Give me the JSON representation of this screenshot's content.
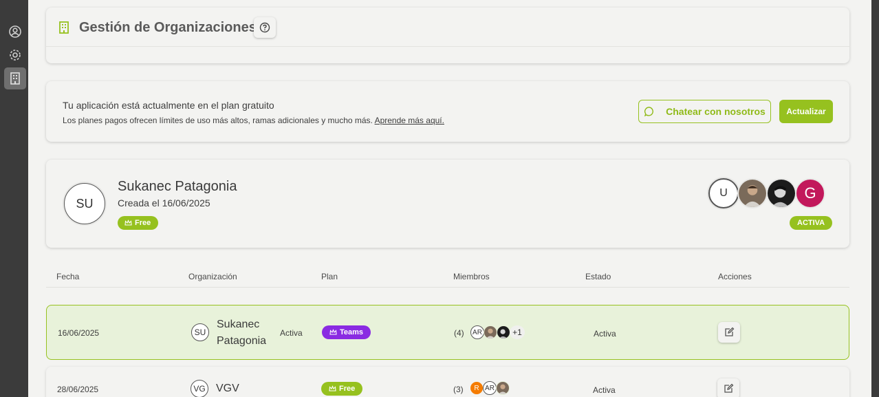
{
  "header": {
    "title": "Gestión de Organizaciones"
  },
  "plan_banner": {
    "line1": "Tu aplicación está actualmente en el plan gratuito",
    "line2": "Los planes pagos ofrecen límites de uso más altos, ramas adicionales y mucho más.",
    "learn_more": "Aprende más aquí.",
    "chat_label": "Chatear con nosotros",
    "upgrade_label": "Actualizar"
  },
  "org": {
    "initials": "SU",
    "name": "Sukanec Patagonia",
    "created": "Creada el 16/06/2025",
    "plan": "Free",
    "status": "ACTIVA",
    "members": [
      {
        "type": "initial",
        "label": "U"
      },
      {
        "type": "photo",
        "icon": "person-photo-1"
      },
      {
        "type": "photo",
        "icon": "person-photo-2"
      },
      {
        "type": "initial",
        "label": "G",
        "color": "#c2185b"
      }
    ]
  },
  "table": {
    "headers": [
      "Fecha",
      "Organización",
      "Plan",
      "Miembros",
      "Estado",
      "Acciones"
    ],
    "rows": [
      {
        "date": "16/06/2025",
        "initials": "SU",
        "name_line1": "Sukanec",
        "name_line2": "Patagonia",
        "org_status": "Activa",
        "plan": "Teams",
        "member_count": "(4)",
        "member_initial": "AR",
        "more": "+1",
        "status": "Activa"
      },
      {
        "date": "28/06/2025",
        "initials": "VG",
        "name": "VGV",
        "plan": "Free",
        "member_count": "(3)",
        "member_r": "R",
        "member_initial": "AR",
        "status": "Activa"
      }
    ]
  },
  "colors": {
    "accent": "#96c11f",
    "teams": "#8a2be2",
    "sidebar": "#3b3b3b"
  }
}
